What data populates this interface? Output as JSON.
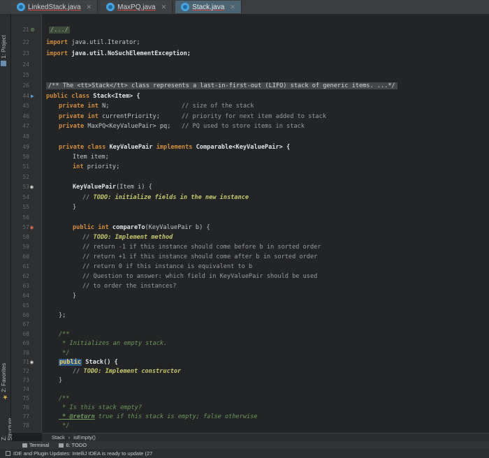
{
  "tabs": [
    {
      "label": "LinkedStack.java",
      "active": false
    },
    {
      "label": "MaxPQ.java",
      "active": false
    },
    {
      "label": "Stack.java",
      "active": true
    }
  ],
  "tool_windows": {
    "project": "1: Project",
    "favorites": "2: Favorites",
    "structure": "Z: Structure"
  },
  "gutter": {
    "line_numbers": [
      "21",
      "22",
      "23",
      "24",
      "25",
      "26",
      "44",
      "45",
      "46",
      "47",
      "48",
      "49",
      "50",
      "51",
      "52",
      "53",
      "54",
      "55",
      "56",
      "57",
      "58",
      "59",
      "60",
      "61",
      "62",
      "63",
      "64",
      "65",
      "66",
      "67",
      "68",
      "69",
      "70",
      "71",
      "72",
      "73",
      "74",
      "75",
      "76",
      "77",
      "78"
    ]
  },
  "code": {
    "l21": "/.../",
    "l22_kw": "import",
    "l22_rest": " java.util.Iterator;",
    "l23_kw": "import",
    "l23_rest": " java.util.NoSuchElementException;",
    "l26_banner": "/** The <tt>Stack</tt> class represents a last-in-first-out (LIFO) stack of generic items. ...*/",
    "l44_kw": "public class",
    "l44_rest": " Stack<Item> {",
    "l45_kw": "private int",
    "l45_rest": " N;",
    "l45_cm": "// size of the stack",
    "l46_kw": "private int",
    "l46_rest": " currentPriority;",
    "l46_cm": "// priority for next item added to stack",
    "l47_kw": "private",
    "l47_rest": " MaxPQ<KeyValuePair> pq;",
    "l47_cm": "// PQ used to store items in stack",
    "l49_kw": "private class",
    "l49_name": " KeyValuePair ",
    "l49_kw2": "implements",
    "l49_rest": " Comparable<KeyValuePair> {",
    "l50": "Item item;",
    "l51_kw": "int",
    "l51_rest": " priority;",
    "l53_name": "KeyValuePair",
    "l53_rest": "(Item i) {",
    "l54_cm": "// ",
    "l54_todo": "TODO: initialize fields in the new instance",
    "l55": "}",
    "l57_kw": "public int",
    "l57_name": " compareTo",
    "l57_rest": "(KeyValuePair b) {",
    "l58_cm": "// ",
    "l58_todo": "TODO: Implement method",
    "l59": "// return -1 if this instance should come before b in sorted order",
    "l60": "// return +1 if this instance should come after b in sorted order",
    "l61": "// return 0 if this instance is equivalent to b",
    "l62": "// Question to answer: which field in KeyValuePair should be used",
    "l63": "// to order the instances?",
    "l64": "}",
    "l66": "};",
    "l68": "/**",
    "l69": " * Initializes an empty stack.",
    "l70": " */",
    "l71_sel": "public",
    "l71_rest": " Stack() {",
    "l72_cm": "// ",
    "l72_todo": "TODO: Implement constructor",
    "l73": "}",
    "l75": "/**",
    "l76": " * Is this stack empty?",
    "l77_tag": " * @return",
    "l77_rest": " true if this stack is empty; false otherwise",
    "l78": " */"
  },
  "breadcrumb": [
    "Stack",
    "isEmpty()"
  ],
  "bottom_tools": [
    "Terminal",
    "6: TODO"
  ],
  "status_text": "IDE and Plugin Updates: IntelliJ IDEA is ready to update (27"
}
